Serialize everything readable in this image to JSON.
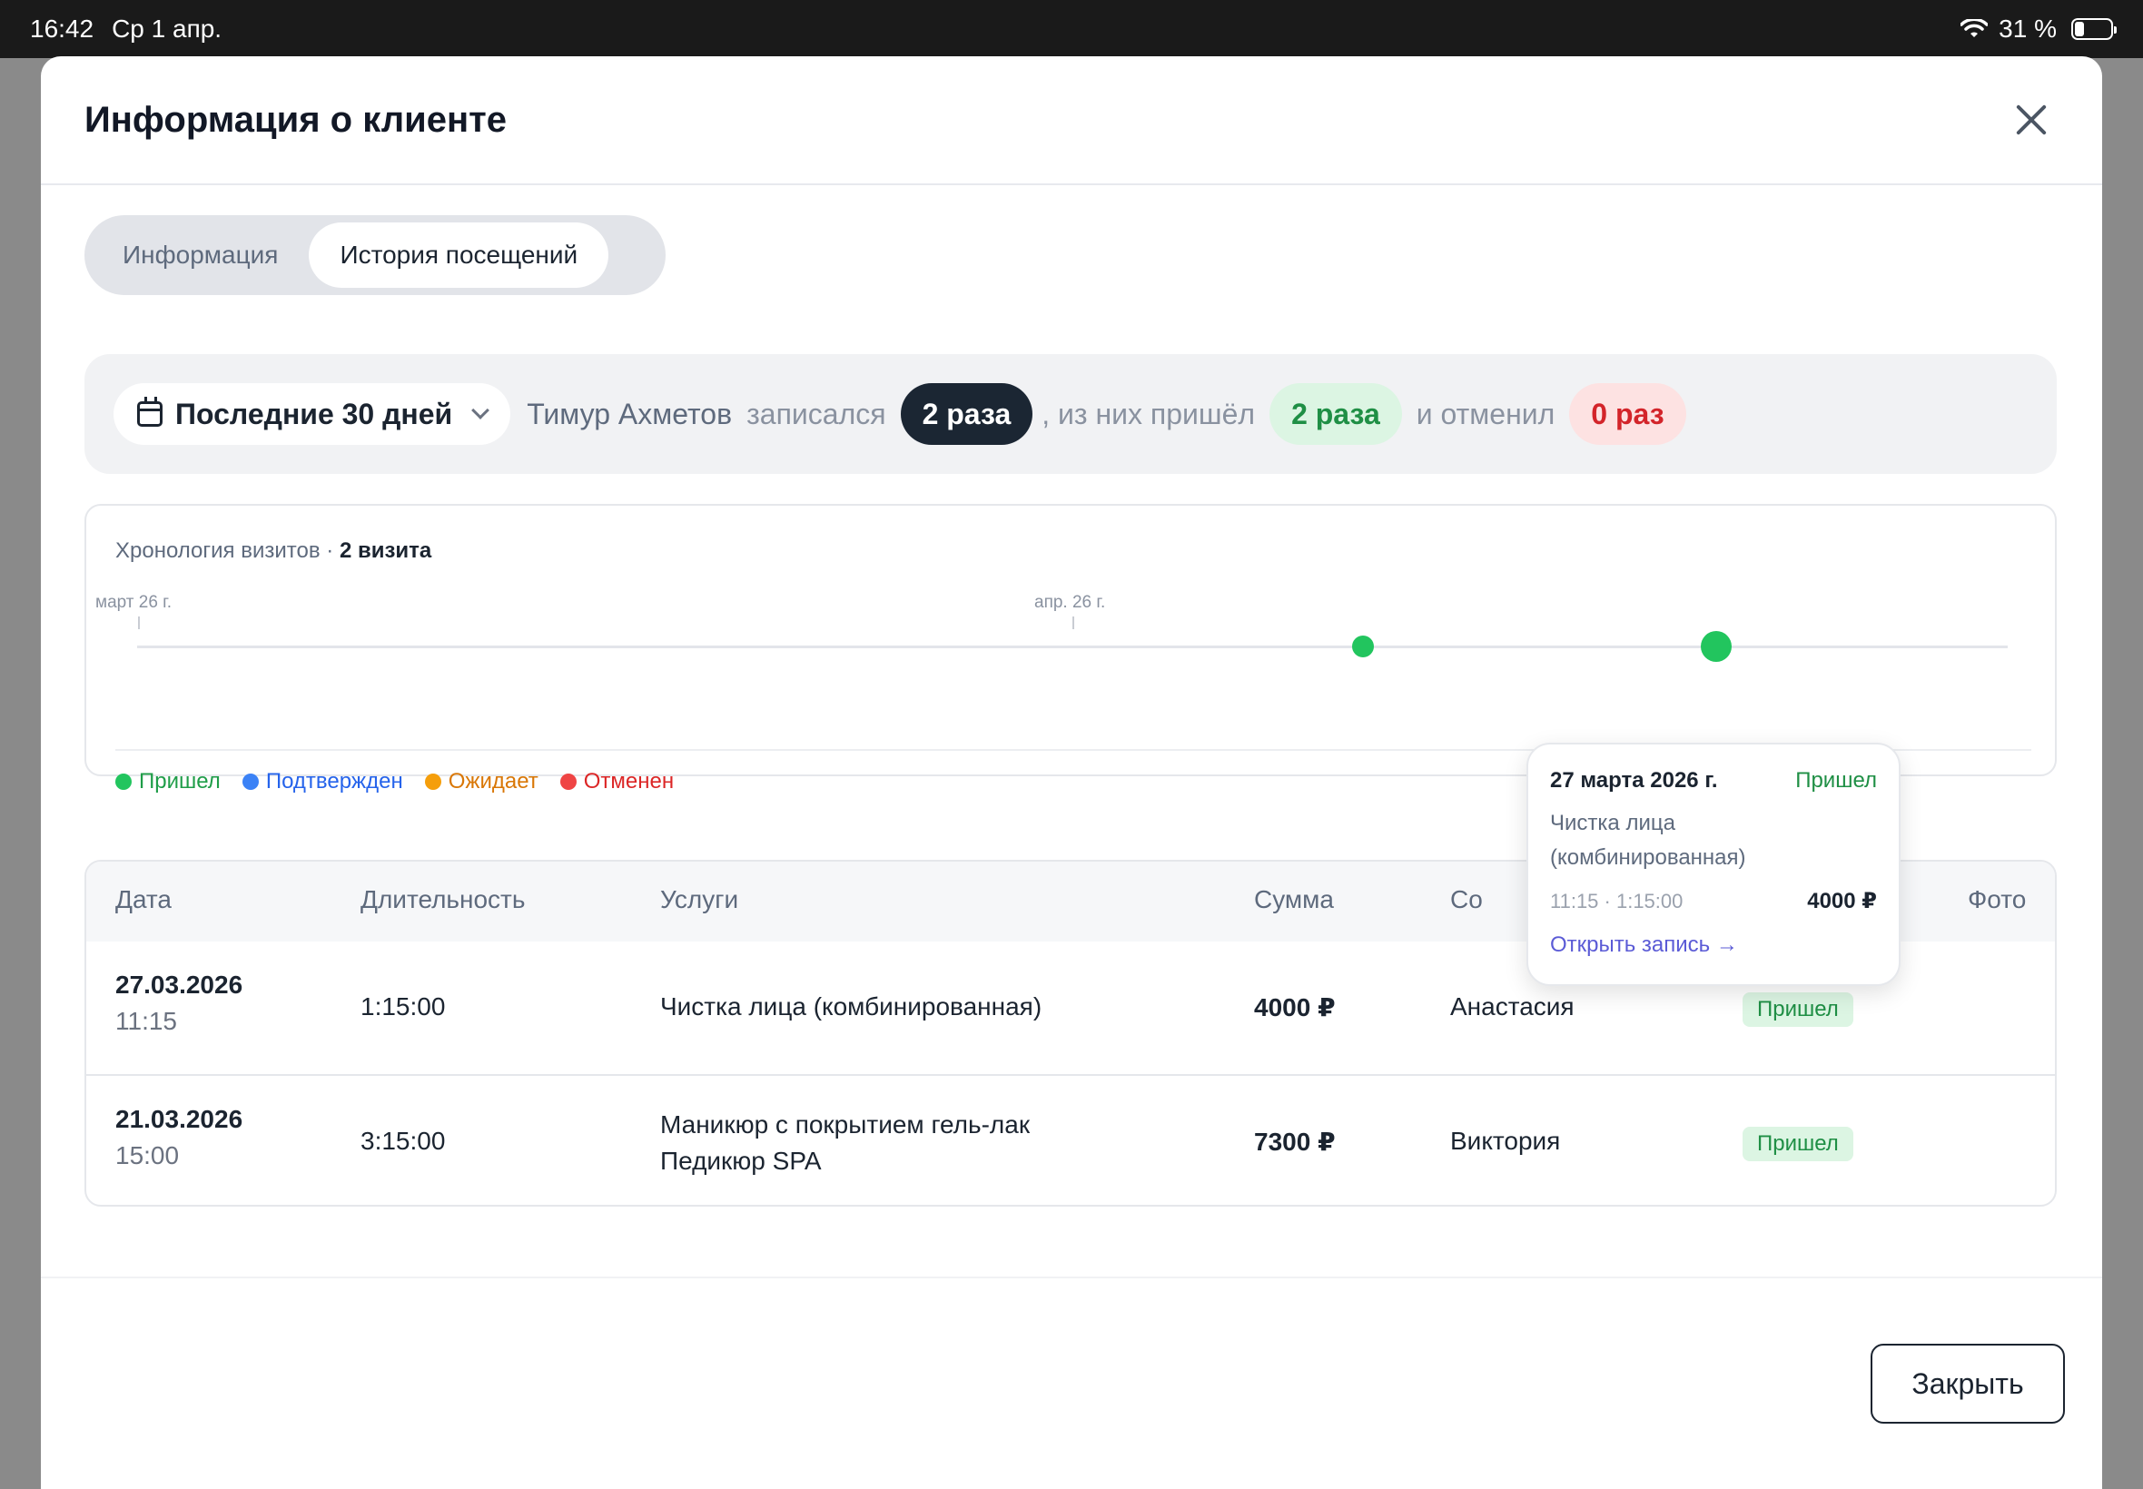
{
  "status_bar": {
    "time": "16:42",
    "date": "Ср 1 апр.",
    "battery": "31 %"
  },
  "modal": {
    "title": "Информация о клиенте"
  },
  "tabs": [
    {
      "label": "Информация",
      "active": false
    },
    {
      "label": "История посещений",
      "active": true
    }
  ],
  "summary": {
    "period": "Последние 30 дней",
    "client_name": "Тимур Ахметов",
    "text_booked": "записался",
    "booked_count": "2 раза",
    "text_came": ", из них пришёл",
    "came_count": "2 раза",
    "text_cancelled": "и отменил",
    "cancelled_count": "0 раз"
  },
  "timeline": {
    "title": "Хронология визитов · ",
    "count": "2 визита",
    "ticks": [
      "март 26 г.",
      "апр. 26 г."
    ],
    "legend": [
      {
        "label": "Пришел",
        "color": "#22c55e",
        "text_color": "#1f9d48"
      },
      {
        "label": "Подтвержден",
        "color": "#3b82f6",
        "text_color": "#2563eb"
      },
      {
        "label": "Ожидает",
        "color": "#f59e0b",
        "text_color": "#d97706"
      },
      {
        "label": "Отменен",
        "color": "#ef4444",
        "text_color": "#dc2626"
      }
    ]
  },
  "popover": {
    "date": "27 марта 2026 г.",
    "status": "Пришел",
    "service": "Чистка лица (комбинированная)",
    "time": "11:15 · 1:15:00",
    "sum": "4000 ₽",
    "link": "Открыть запись →"
  },
  "table": {
    "headers": {
      "date": "Дата",
      "duration": "Длительность",
      "services": "Услуги",
      "sum": "Сумма",
      "staff": "Со",
      "photo": "Фото"
    },
    "rows": [
      {
        "date": "27.03.2026",
        "time": "11:15",
        "duration": "1:15:00",
        "services": [
          "Чистка лица (комбинированная)"
        ],
        "sum": "4000 ₽",
        "staff": "Анастасия",
        "status": "Пришел"
      },
      {
        "date": "21.03.2026",
        "time": "15:00",
        "duration": "3:15:00",
        "services": [
          "Маникюр с покрытием гель-лак",
          "Педикюр SPA"
        ],
        "sum": "7300 ₽",
        "staff": "Виктория",
        "status": "Пришел"
      }
    ]
  },
  "footer": {
    "close_label": "Закрыть"
  },
  "colors": {
    "accent_dark": "#1b2633",
    "success": "#22c55e",
    "danger": "#d3242a",
    "link": "#5b5bd6"
  }
}
